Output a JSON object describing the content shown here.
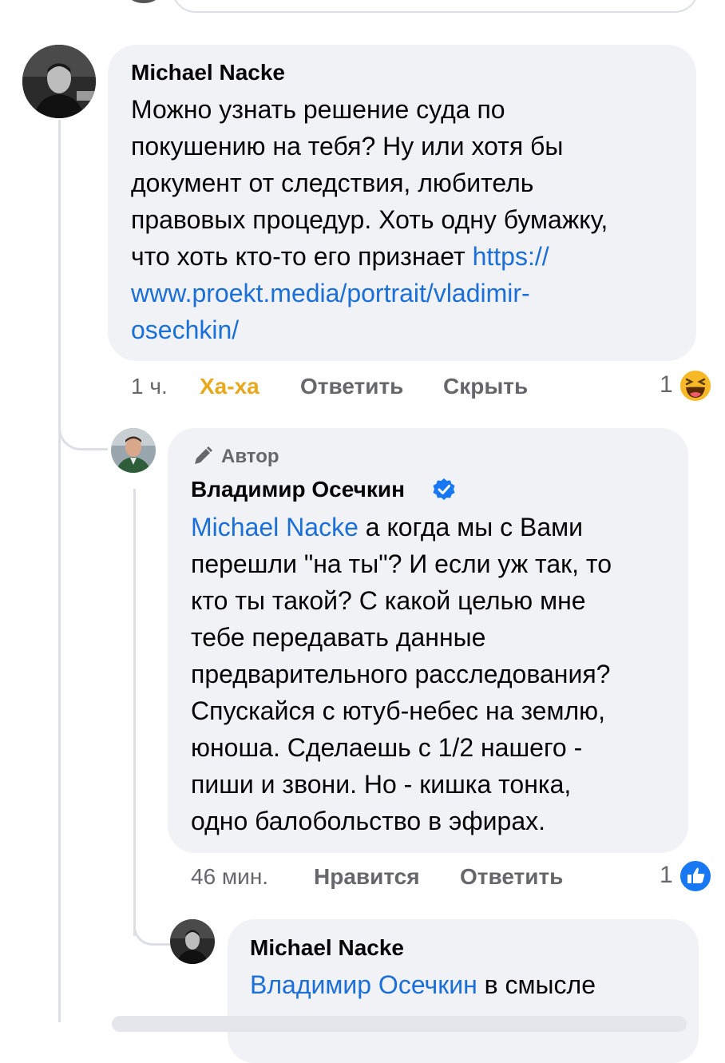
{
  "comment1": {
    "author": "Michael Nacke",
    "lines": [
      "Можно узнать решение суда по",
      "покушению на тебя? Ну или хотя бы",
      "документ от следствия, любитель",
      "правовых процедур. Хоть одну бумажку,",
      "что хоть кто-то его признает "
    ],
    "link_line1": "https://",
    "link_line2": "www.proekt.media/portrait/vladimir-",
    "link_line3": "osechkin/",
    "time": "1 ч.",
    "reaction_label": "Ха-ха",
    "reply_label": "Ответить",
    "hide_label": "Скрыть",
    "reaction_count": "1",
    "reaction_icon": "haha-emoji-icon"
  },
  "comment2": {
    "badge": "Автор",
    "author": "Владимир Осечкин",
    "verified_icon": "verified-badge-icon",
    "mention": "Michael Nacke",
    "first_line_rest": " а когда мы с Вами",
    "lines": [
      "перешли \"на ты\"? И если уж так, то",
      "кто ты такой? С какой целью мне",
      "тебе передавать данные",
      "предварительного расследования?",
      "Спускайся с ютуб-небес на землю,",
      "юноша. Сделаешь с 1/2 нашего -",
      "пиши и звони. Но - кишка тонка,",
      "одно балобольство в эфирах."
    ],
    "time": "46 мин.",
    "like_label": "Нравится",
    "reply_label": "Ответить",
    "reaction_count": "1",
    "reaction_icon": "like-icon"
  },
  "comment3": {
    "author": "Michael Nacke",
    "mention": "Владимир Осечкин",
    "first_line_rest": " в смысле"
  },
  "colors": {
    "bubble": "#f0f2f5",
    "link": "#1b6fd8",
    "haha": "#e8a81c",
    "muted": "#65676b",
    "verified": "#1877f2"
  }
}
